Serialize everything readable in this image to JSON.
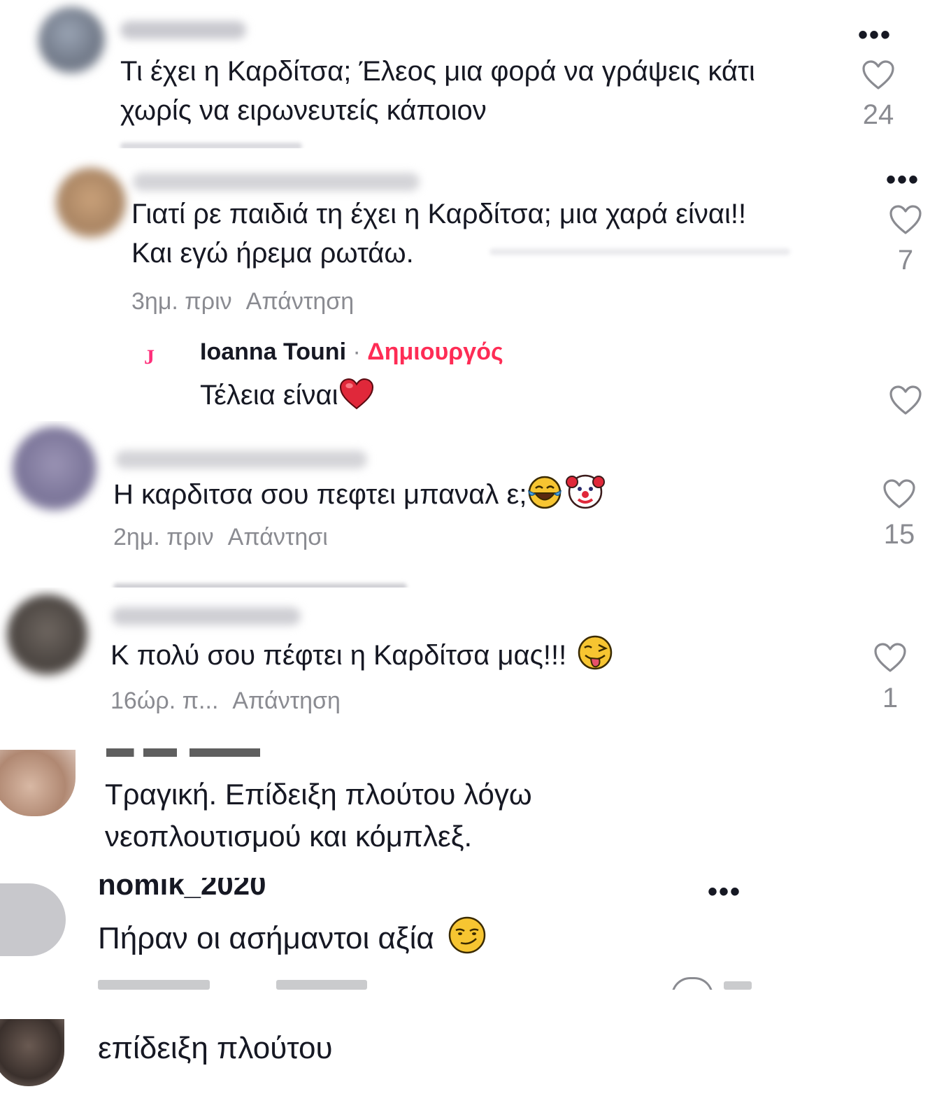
{
  "comments": [
    {
      "text": "Τι έχει η Καρδίτσα; Έλεος μια φορά να γράψεις κάτι\nχωρίς να ειρωνευτείς κάποιον",
      "more": "•••",
      "likes": "24"
    },
    {
      "text": "Γιατί ρε παιδιά τη έχει η Καρδίτσα; μια χαρά είναι!!\nΚαι εγώ ήρεμα ρωτάω.",
      "time": "3ημ. πριν",
      "reply": "Απάντηση",
      "more": "•••",
      "likes": "7",
      "creator_reply": {
        "avatar_letter": "J",
        "name": "Ioanna Touni",
        "separator": "·",
        "badge": "Δημιουργός",
        "text": "Τέλεια είναι"
      }
    },
    {
      "text": "Η καρδιτσα σου πεφτει μπαναλ ε;",
      "time": "2ημ. πριν",
      "reply": "Απάντησι",
      "likes": "15"
    },
    {
      "text": "Κ πολύ σου πέφτει η Καρδίτσα μας!!!",
      "time": "16ώρ. π...",
      "reply": "Απάντηση",
      "likes": "1"
    },
    {
      "text": "Τραγική. Επίδειξη πλούτου λόγω\nνεοπλουτισμού και κόμπλεξ."
    },
    {
      "username": "nomik_2020",
      "text": "Πήραν οι ασήμαντοι αξία",
      "more": "•••"
    },
    {
      "text": "επίδειξη πλούτου"
    }
  ],
  "colors": {
    "text": "#161823",
    "secondary": "#8a8b91",
    "creator_badge": "#fe2c55",
    "avatar_letter": "#ff2e7a"
  }
}
